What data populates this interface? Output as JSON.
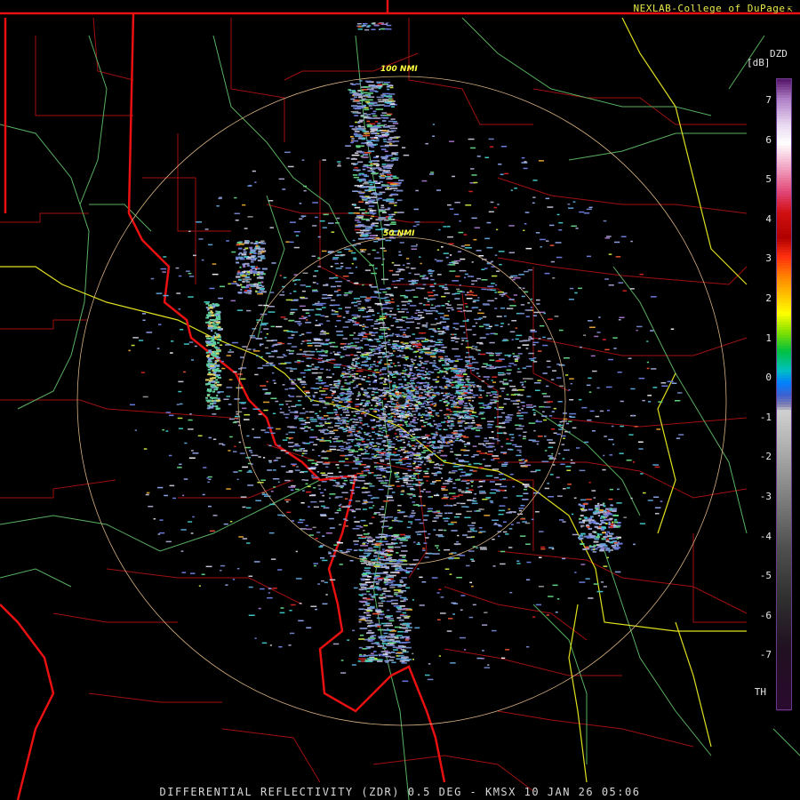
{
  "credit": {
    "text": "NEXLAB-College of DuPage",
    "icon": "external-link-icon"
  },
  "footer": {
    "text": "DIFFERENTIAL REFLECTIVITY (ZDR) 0.5 DEG - KMSX 10 JAN 26 05:06"
  },
  "range_rings": [
    {
      "label": "100 NMI"
    },
    {
      "label": "50 NMI"
    }
  ],
  "legend": {
    "product": "DZD",
    "unit": "[dB]",
    "ticks": [
      "7",
      "6",
      "5",
      "4",
      "3",
      "2",
      "1",
      "0",
      "-1",
      "-2",
      "-3",
      "-4",
      "-5",
      "-6",
      "-7",
      "TH"
    ],
    "colors": {
      "border": "#6a3a8a",
      "tick_text": "#e8e8e8"
    }
  },
  "colors": {
    "background": "#000000",
    "state_border": "#e81010",
    "county_border": "#a01010",
    "highway": "#e0e020",
    "river": "#58b060",
    "range_ring": "#d8b080",
    "ring_label": "#ffff40",
    "credit_text": "#e8e84a"
  }
}
